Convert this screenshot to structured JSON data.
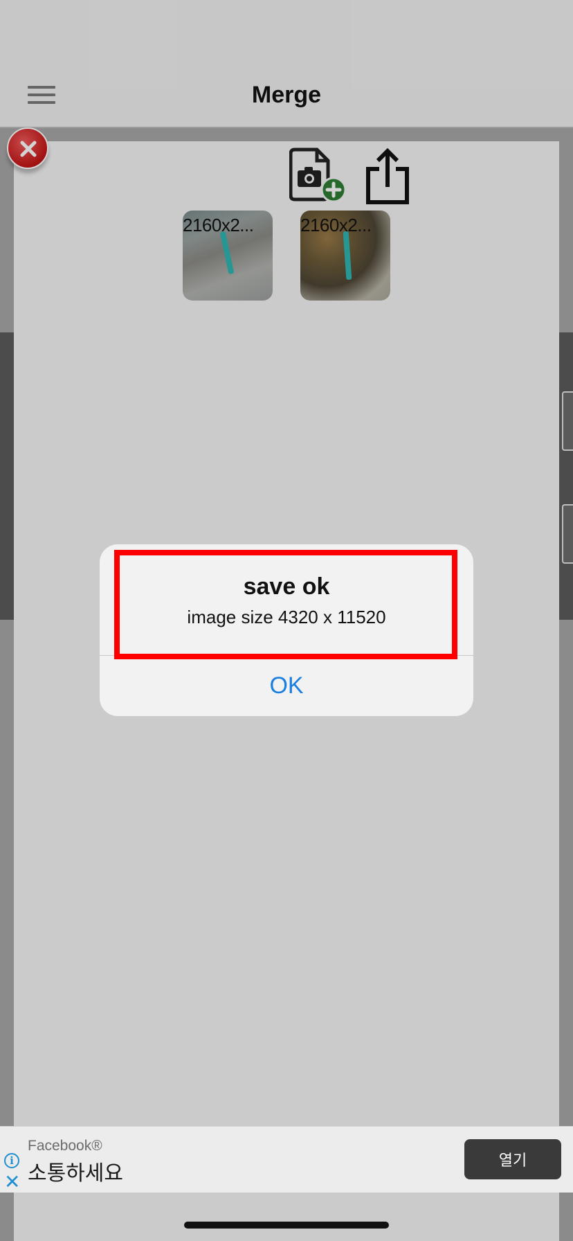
{
  "nav": {
    "title": "Merge",
    "menu_icon": "hamburger-menu-icon"
  },
  "toolbar": {
    "close_icon": "close-icon",
    "add_photo_icon": "add-photo-icon",
    "share_icon": "share-icon"
  },
  "thumbnails": [
    {
      "label": "2160x2..."
    },
    {
      "label": "2160x2..."
    }
  ],
  "alert": {
    "title": "save ok",
    "message": "image size 4320 x 11520",
    "ok_label": "OK"
  },
  "ad": {
    "brand": "Facebook®",
    "headline": "소통하세요",
    "open_label": "열기",
    "info_icon": "info-icon",
    "dismiss_icon": "close-icon"
  },
  "colors": {
    "accent": "#1a7fe0",
    "highlight": "#ff0000",
    "close_button": "#c41616",
    "add_badge": "#2e7d32"
  }
}
